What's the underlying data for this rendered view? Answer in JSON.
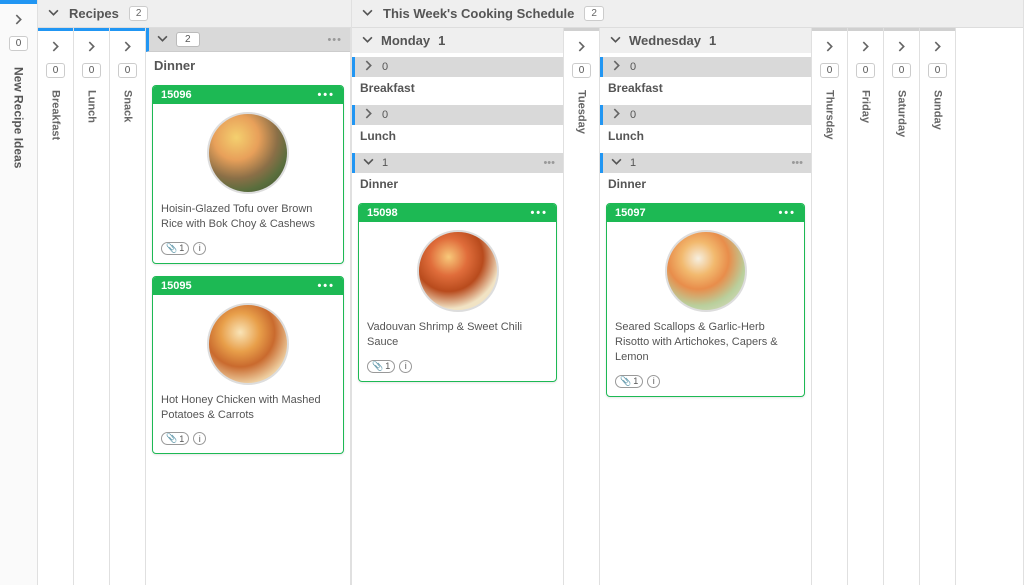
{
  "col_new_ideas": {
    "label": "New Recipe Ideas",
    "count": "0"
  },
  "group_recipes": {
    "title": "Recipes",
    "count": "2",
    "lanes_collapsed": [
      {
        "label": "Breakfast",
        "count": "0"
      },
      {
        "label": "Lunch",
        "count": "0"
      },
      {
        "label": "Snack",
        "count": "0"
      }
    ],
    "dinner": {
      "title": "Dinner",
      "count": "2",
      "cards": [
        {
          "id": "15096",
          "desc": "Hoisin-Glazed Tofu over Brown Rice with Bok Choy & Cashews",
          "attach": "1"
        },
        {
          "id": "15095",
          "desc": "Hot Honey Chicken with Mashed Potatoes & Carrots",
          "attach": "1"
        }
      ]
    }
  },
  "group_schedule": {
    "title": "This Week's Cooking Schedule",
    "count": "2",
    "days_collapsed_right": [
      {
        "label": "Thursday",
        "count": "0"
      },
      {
        "label": "Friday",
        "count": "0"
      },
      {
        "label": "Saturday",
        "count": "0"
      },
      {
        "label": "Sunday",
        "count": "0"
      }
    ],
    "tuesday": {
      "label": "Tuesday",
      "count": "0"
    },
    "monday": {
      "label": "Monday",
      "count": "1",
      "breakfast": {
        "title": "Breakfast",
        "count": "0"
      },
      "lunch": {
        "title": "Lunch",
        "count": "0"
      },
      "dinner": {
        "title": "Dinner",
        "count": "1",
        "card": {
          "id": "15098",
          "desc": "Vadouvan Shrimp & Sweet Chili Sauce",
          "attach": "1"
        }
      }
    },
    "wednesday": {
      "label": "Wednesday",
      "count": "1",
      "breakfast": {
        "title": "Breakfast",
        "count": "0"
      },
      "lunch": {
        "title": "Lunch",
        "count": "0"
      },
      "dinner": {
        "title": "Dinner",
        "count": "1",
        "card": {
          "id": "15097",
          "desc": "Seared Scallops & Garlic-Herb Risotto with Artichokes, Capers & Lemon",
          "attach": "1"
        }
      }
    }
  }
}
